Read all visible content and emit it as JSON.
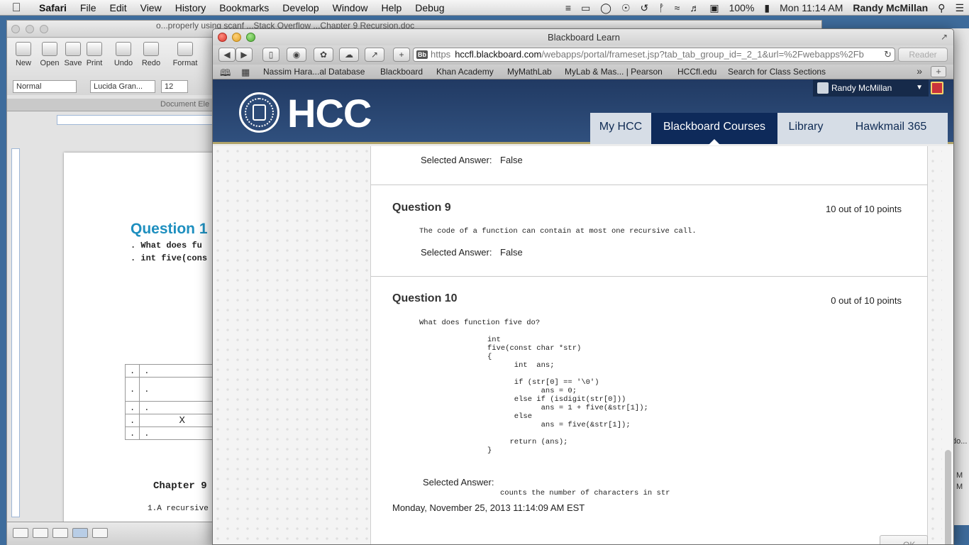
{
  "menubar": {
    "app": "Safari",
    "items": [
      "File",
      "Edit",
      "View",
      "History",
      "Bookmarks",
      "Develop",
      "Window",
      "Help",
      "Debug"
    ],
    "battery": "100%",
    "clock": "Mon 11:14 AM",
    "user": "Randy McMillan"
  },
  "word": {
    "title": "o...properly using scanf  ...Stack Overflow   ...Chapter 9 Recursion.doc",
    "toolbar": [
      "New",
      "Open",
      "Save",
      "Print",
      "Undo",
      "Redo",
      "Format"
    ],
    "style_select": "Normal",
    "font_select": "Lucida Gran...",
    "size_select": "12",
    "doc_bar": "Document Ele",
    "page": {
      "heading": "Question 1",
      "line1": ".  What does fu",
      "line2": ". int five(cons",
      "table_mark": "X",
      "chapter": "Chapter 9",
      "recursive": "1.A recursive"
    }
  },
  "bgright": {
    "text1": "do...",
    "text2": "M",
    "text3": "M"
  },
  "safari": {
    "window_title": "Blackboard Learn",
    "url": {
      "scheme": "https",
      "host": "hccfl.blackboard.com",
      "path": "/webapps/portal/frameset.jsp?tab_tab_group_id=_2_1&url=%2Fwebapps%2Fb"
    },
    "reader": "Reader",
    "bookmarks": [
      "Nassim Hara...al Database",
      "Blackboard",
      "Khan Academy",
      "MyMathLab",
      "MyLab & Mas... | Pearson",
      "HCCfl.edu",
      "Search for Class Sections"
    ]
  },
  "hcc": {
    "logo": "HCC",
    "user": "Randy McMillan",
    "tabs": [
      "My HCC",
      "Blackboard Courses",
      "Library",
      "Hawkmail 365"
    ],
    "active_tab": "Blackboard Courses"
  },
  "content": {
    "prev_selected_label": "Selected Answer:",
    "prev_selected_value": "False",
    "q9": {
      "title": "Question 9",
      "points": "10 out of 10 points",
      "text": "The code of a function can contain at most one recursive call.",
      "selected_label": "Selected Answer:",
      "selected_value": "False"
    },
    "q10": {
      "title": "Question 10",
      "points": "0 out of 10 points",
      "text": "What does function five do?",
      "code": "int\nfive(const char *str)\n{\n      int  ans;\n\n      if (str[0] == '\\0')\n            ans = 0;\n      else if (isdigit(str[0]))\n            ans = 1 + five(&str[1]);\n      else\n            ans = five(&str[1]);\n\n     return (ans);\n}",
      "selected_label": "Selected Answer:",
      "selected_value": "counts the number of characters in str"
    },
    "timestamp": "Monday, November 25, 2013 11:14:09 AM EST",
    "ok_button": "OK"
  }
}
